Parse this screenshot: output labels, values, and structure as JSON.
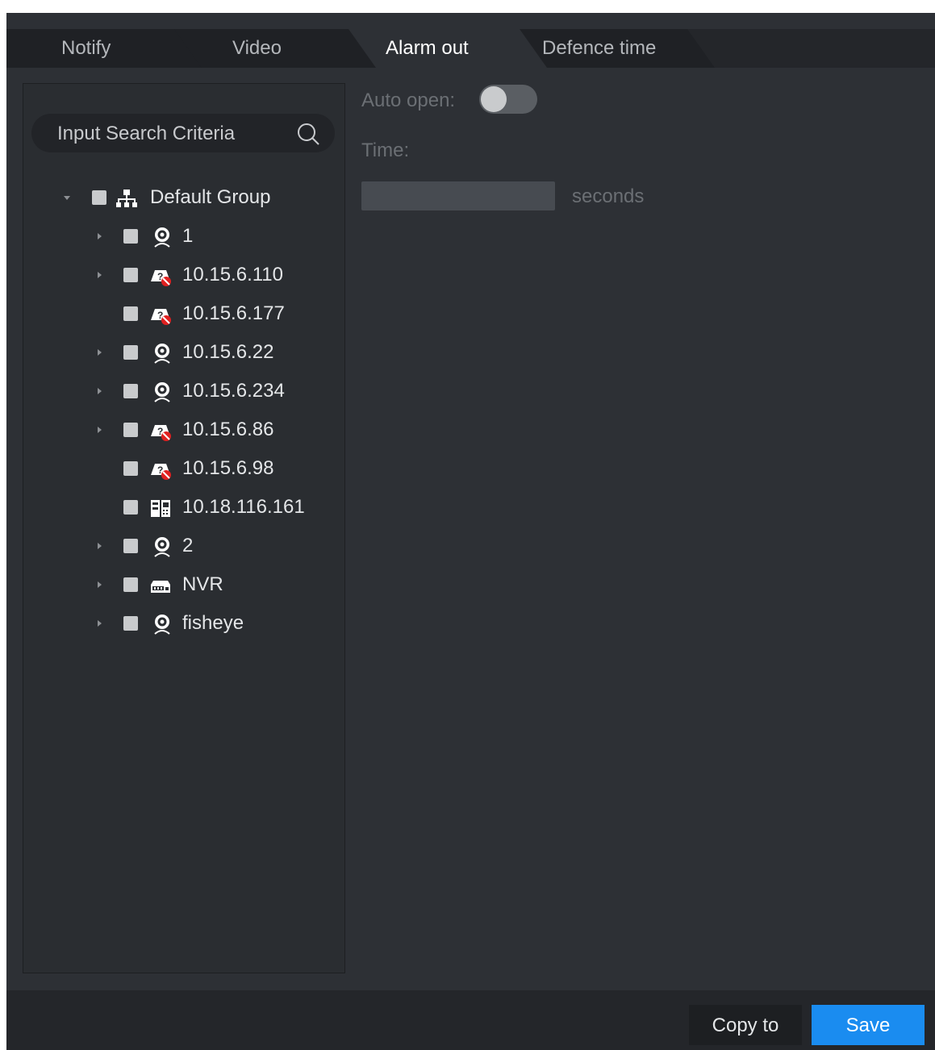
{
  "tabs": [
    {
      "label": "Notify"
    },
    {
      "label": "Video"
    },
    {
      "label": "Alarm out"
    },
    {
      "label": "Defence time"
    }
  ],
  "active_tab": "Alarm out",
  "search": {
    "placeholder": "Input Search Criteria"
  },
  "tree": {
    "root": {
      "label": "Default Group",
      "icon": "org-tree-icon"
    },
    "items": [
      {
        "label": "1",
        "icon": "camera-icon",
        "expandable": true
      },
      {
        "label": "10.15.6.110",
        "icon": "offline-device-icon",
        "expandable": true
      },
      {
        "label": "10.15.6.177",
        "icon": "offline-device-icon",
        "expandable": false
      },
      {
        "label": "10.15.6.22",
        "icon": "camera-icon",
        "expandable": true
      },
      {
        "label": "10.15.6.234",
        "icon": "camera-icon",
        "expandable": true
      },
      {
        "label": "10.15.6.86",
        "icon": "offline-device-icon",
        "expandable": true
      },
      {
        "label": "10.15.6.98",
        "icon": "offline-device-icon",
        "expandable": false
      },
      {
        "label": "10.18.116.161",
        "icon": "door-station-icon",
        "expandable": false
      },
      {
        "label": "2",
        "icon": "camera-icon",
        "expandable": true
      },
      {
        "label": "NVR",
        "icon": "nvr-icon",
        "expandable": true
      },
      {
        "label": "fisheye",
        "icon": "camera-icon",
        "expandable": true
      }
    ]
  },
  "settings": {
    "auto_open_label": "Auto open:",
    "auto_open_on": false,
    "time_label": "Time:",
    "time_value": "",
    "time_unit": "seconds"
  },
  "footer": {
    "copy_label": "Copy to",
    "save_label": "Save"
  },
  "colors": {
    "accent": "#1a8cf0",
    "background": "#2d3035"
  }
}
